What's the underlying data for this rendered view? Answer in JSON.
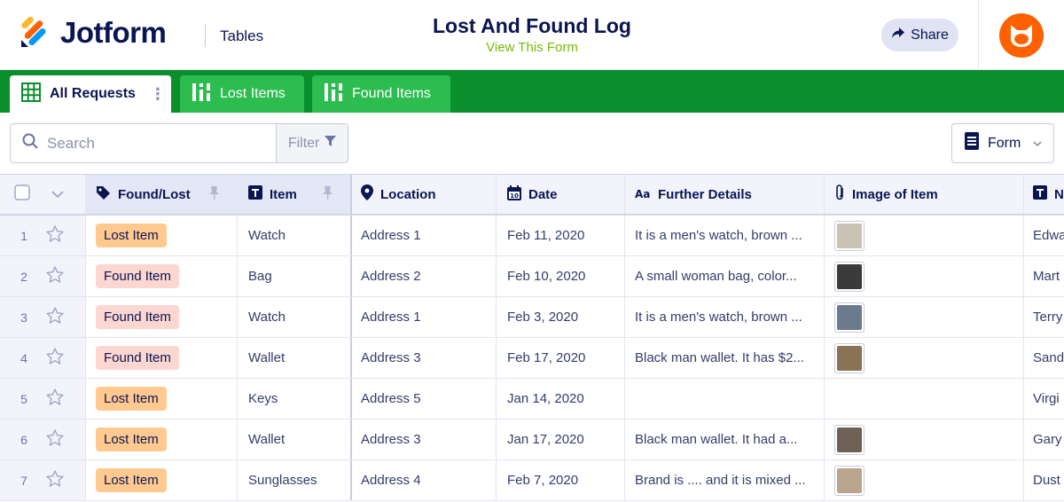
{
  "header": {
    "brand": "Jotform",
    "section": "Tables",
    "form_title": "Lost And Found Log",
    "view_form_link": "View This Form",
    "share_label": "Share",
    "accent_color": "#0b8f2d"
  },
  "tabs": [
    {
      "label": "All Requests",
      "icon": "grid-icon",
      "active": true
    },
    {
      "label": "Lost Items",
      "icon": "report-icon",
      "active": false
    },
    {
      "label": "Found Items",
      "icon": "report-icon",
      "active": false
    }
  ],
  "toolbar": {
    "search_placeholder": "Search",
    "filter_label": "Filter",
    "form_button_label": "Form"
  },
  "table": {
    "columns": [
      {
        "label": "Found/Lost",
        "icon": "tag-icon",
        "pinned": true
      },
      {
        "label": "Item",
        "icon": "text-icon",
        "pinned": true
      },
      {
        "label": "Location",
        "icon": "location-pin-icon"
      },
      {
        "label": "Date",
        "icon": "calendar-icon"
      },
      {
        "label": "Further Details",
        "icon": "aa-text-icon"
      },
      {
        "label": "Image of Item",
        "icon": "paperclip-icon"
      },
      {
        "label": "N",
        "icon": "text-icon"
      }
    ],
    "rows": [
      {
        "num": "1",
        "status": "Lost Item",
        "item": "Watch",
        "location": "Address 1",
        "date": "Feb 11, 2020",
        "details": "It is a men's watch, brown ...",
        "has_image": true,
        "name": "Edwa"
      },
      {
        "num": "2",
        "status": "Found Item",
        "item": "Bag",
        "location": "Address 2",
        "date": "Feb 10, 2020",
        "details": "A small woman bag, color...",
        "has_image": true,
        "name": "Mart"
      },
      {
        "num": "3",
        "status": "Found Item",
        "item": "Watch",
        "location": "Address 1",
        "date": "Feb 3, 2020",
        "details": "It is a men's watch, brown ...",
        "has_image": true,
        "name": "Terry"
      },
      {
        "num": "4",
        "status": "Found Item",
        "item": "Wallet",
        "location": "Address 3",
        "date": "Feb 17, 2020",
        "details": "Black man wallet. It has $2...",
        "has_image": true,
        "name": "Sand"
      },
      {
        "num": "5",
        "status": "Lost Item",
        "item": "Keys",
        "location": "Address 5",
        "date": "Jan 14, 2020",
        "details": "",
        "has_image": false,
        "name": "Virgi"
      },
      {
        "num": "6",
        "status": "Lost Item",
        "item": "Wallet",
        "location": "Address 3",
        "date": "Jan 17, 2020",
        "details": "Black man wallet. It had a...",
        "has_image": true,
        "name": "Gary"
      },
      {
        "num": "7",
        "status": "Lost Item",
        "item": "Sunglasses",
        "location": "Address 4",
        "date": "Feb 7, 2020",
        "details": "Brand is .... and it is mixed ...",
        "has_image": true,
        "name": "Dust"
      }
    ]
  }
}
